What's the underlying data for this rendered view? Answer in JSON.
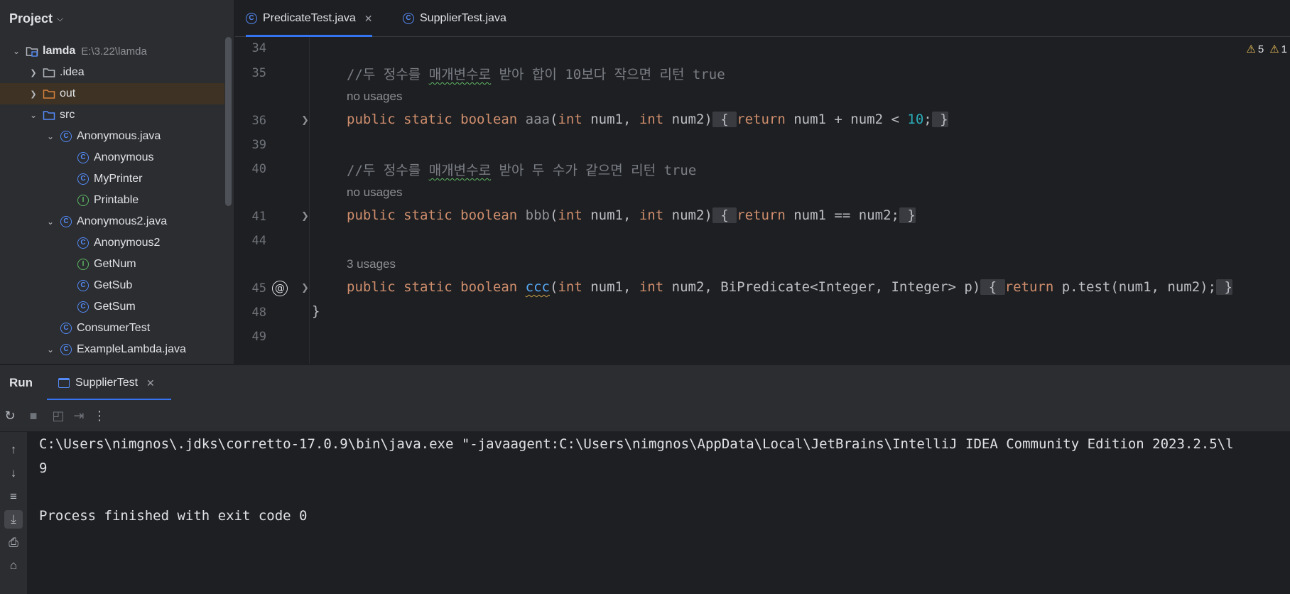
{
  "project": {
    "title": "Project",
    "tree": [
      {
        "label": "lamda",
        "path": "E:\\3.22\\lamda",
        "icon": "module-folder-icon",
        "arrow": "expanded",
        "indent": 0,
        "bold": true
      },
      {
        "label": ".idea",
        "icon": "folder-icon",
        "arrow": "collapsed",
        "indent": 1
      },
      {
        "label": "out",
        "icon": "folder-orange-icon",
        "arrow": "collapsed",
        "indent": 1,
        "highlight": true
      },
      {
        "label": "src",
        "icon": "folder-blue-icon",
        "arrow": "expanded",
        "indent": 1
      },
      {
        "label": "Anonymous.java",
        "icon": "class-icon",
        "arrow": "expanded",
        "indent": 2
      },
      {
        "label": "Anonymous",
        "icon": "class-icon",
        "arrow": "none",
        "indent": 3
      },
      {
        "label": "MyPrinter",
        "icon": "class-icon",
        "arrow": "none",
        "indent": 3
      },
      {
        "label": "Printable",
        "icon": "interface-icon",
        "arrow": "none",
        "indent": 3
      },
      {
        "label": "Anonymous2.java",
        "icon": "class-icon",
        "arrow": "expanded",
        "indent": 2
      },
      {
        "label": "Anonymous2",
        "icon": "class-icon",
        "arrow": "none",
        "indent": 3
      },
      {
        "label": "GetNum",
        "icon": "interface-icon",
        "arrow": "none",
        "indent": 3
      },
      {
        "label": "GetSub",
        "icon": "class-icon",
        "arrow": "none",
        "indent": 3
      },
      {
        "label": "GetSum",
        "icon": "class-icon",
        "arrow": "none",
        "indent": 3
      },
      {
        "label": "ConsumerTest",
        "icon": "class-icon",
        "arrow": "none",
        "indent": 2
      },
      {
        "label": "ExampleLambda.java",
        "icon": "class-icon",
        "arrow": "expanded",
        "indent": 2
      }
    ]
  },
  "editor": {
    "tabs": [
      {
        "label": "PredicateTest.java",
        "active": true,
        "closable": true
      },
      {
        "label": "SupplierTest.java",
        "active": false,
        "closable": false
      }
    ],
    "inspection": {
      "warnings": "5",
      "extra": "1"
    },
    "lines": {
      "l34": "34",
      "l35": "35",
      "l36": "36",
      "l39": "39",
      "l40": "40",
      "l41": "41",
      "l44": "44",
      "l45": "45",
      "l48": "48",
      "l49": "49"
    },
    "code": {
      "c35_a": "//두 정수를 ",
      "c35_b": "매개변수로",
      "c35_c": " 받아 합이 10보다 작으면 리턴 true",
      "u36": "no usages",
      "c36_kw": "public static boolean ",
      "c36_name": "aaa",
      "c36_p1": "(",
      "c36_int1": "int",
      "c36_p2": " num1, ",
      "c36_int2": "int",
      "c36_p3": " num2)",
      "c36_b1": " { ",
      "c36_ret": "return",
      "c36_expr": " num1 + num2 < ",
      "c36_num": "10",
      "c36_semi": ";",
      "c36_b2": " }",
      "c40_a": "//두 정수를 ",
      "c40_b": "매개변수로",
      "c40_c": " 받아 두 수가 같으면 리턴 true",
      "u41": "no usages",
      "c41_kw": "public static boolean ",
      "c41_name": "bbb",
      "c41_p1": "(",
      "c41_int1": "int",
      "c41_p2": " num1, ",
      "c41_int2": "int",
      "c41_p3": " num2)",
      "c41_b1": " { ",
      "c41_ret": "return",
      "c41_expr": " num1 == num2;",
      "c41_b2": " }",
      "u45": "3 usages",
      "c45_kw": "public static boolean ",
      "c45_name": "ccc",
      "c45_p1": "(",
      "c45_int1": "int",
      "c45_p2": " num1, ",
      "c45_int2": "int",
      "c45_p3": " num2, BiPredicate<Integer, Integer> p)",
      "c45_b1": " { ",
      "c45_ret": "return",
      "c45_expr": " p.test(num1, num2);",
      "c45_b2": " }",
      "c48": "}"
    }
  },
  "run": {
    "title": "Run",
    "tab_label": "SupplierTest",
    "console": {
      "cmd": "C:\\Users\\nimgnos\\.jdks\\corretto-17.0.9\\bin\\java.exe \"-javaagent:C:\\Users\\nimgnos\\AppData\\Local\\JetBrains\\IntelliJ IDEA Community Edition 2023.2.5\\l",
      "output": "9",
      "exit": "Process finished with exit code 0"
    }
  }
}
